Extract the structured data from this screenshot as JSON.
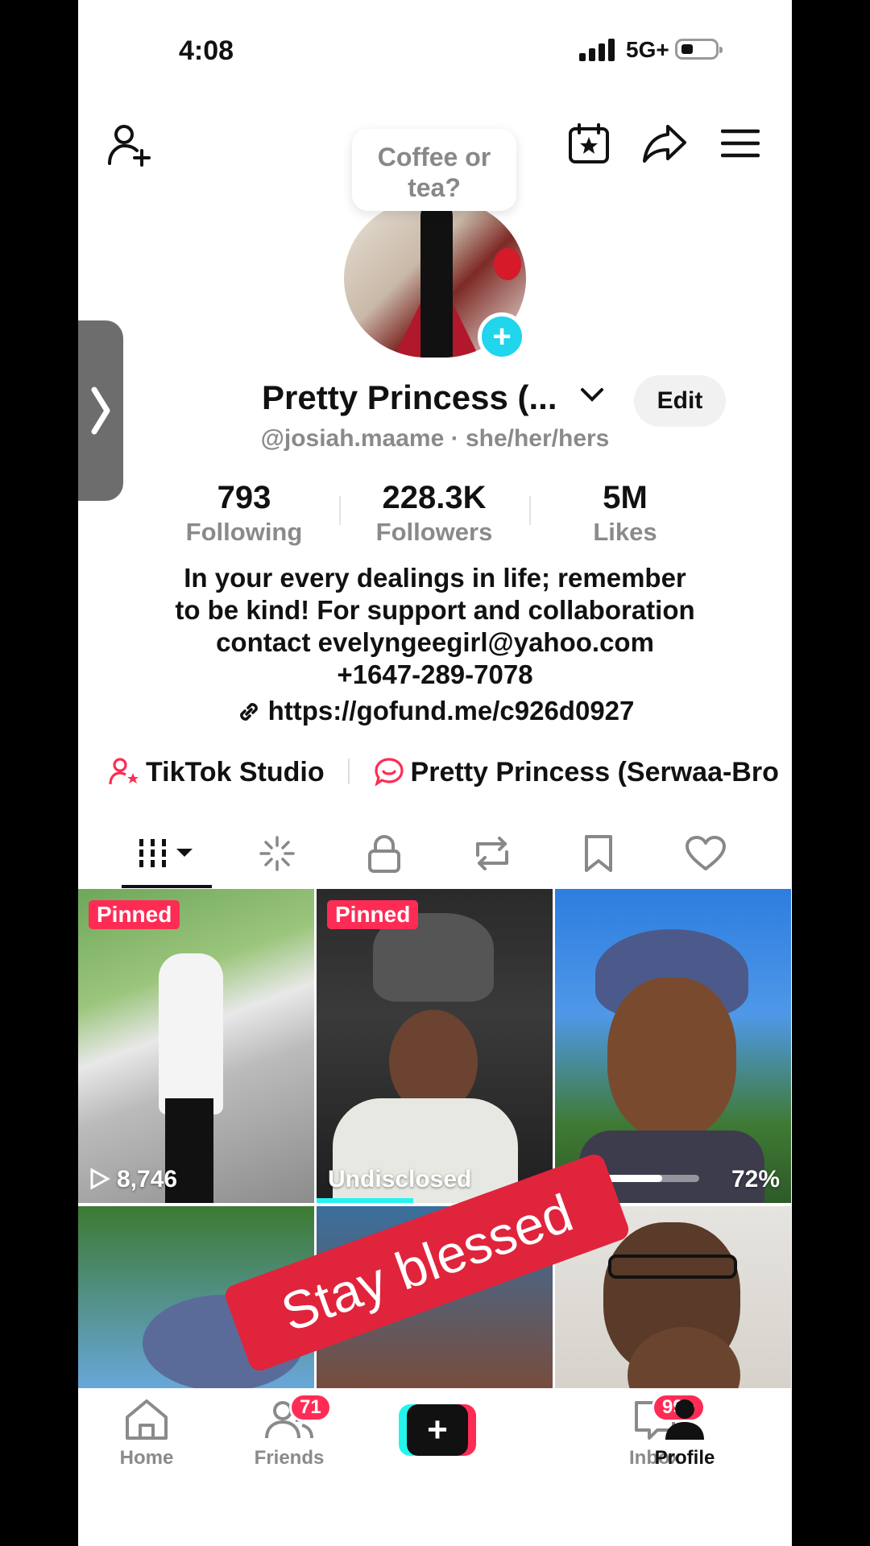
{
  "status": {
    "time": "4:08",
    "network": "5G+"
  },
  "header": {
    "add_friend_icon": "person-plus-icon",
    "calendar_icon": "calendar-star-icon",
    "share_icon": "share-arrow-icon",
    "menu_icon": "hamburger-menu-icon"
  },
  "profile": {
    "note": "Coffee or tea?",
    "name": "Pretty Princess (...",
    "edit_label": "Edit",
    "handle": "@josiah.maame · she/her/hers",
    "stats": [
      {
        "value": "793",
        "label": "Following"
      },
      {
        "value": "228.3K",
        "label": "Followers"
      },
      {
        "value": "5M",
        "label": "Likes"
      }
    ],
    "bio_lines": [
      "In your every dealings in life; remember",
      "to be kind! For support and collaboration",
      "contact evelyngeegirl@yahoo.com",
      "+1647-289-7078"
    ],
    "link": "https://gofund.me/c926d0927",
    "chips": [
      {
        "label": "TikTok Studio",
        "icon": "studio-person-star-icon"
      },
      {
        "label": "Pretty Princess (Serwaa-Bro",
        "icon": "chat-bubble-icon"
      }
    ]
  },
  "tabs": [
    {
      "name": "videos-grid",
      "icon": "grid-bars-icon"
    },
    {
      "name": "reposts-sparkle",
      "icon": "sparkle-icon"
    },
    {
      "name": "private",
      "icon": "lock-icon"
    },
    {
      "name": "reposts",
      "icon": "repost-icon"
    },
    {
      "name": "favorites",
      "icon": "bookmark-icon"
    },
    {
      "name": "liked",
      "icon": "heart-icon"
    }
  ],
  "grid": [
    {
      "pinned": "Pinned",
      "caption": "8,746",
      "caption_icon": "play-icon"
    },
    {
      "pinned": "Pinned",
      "caption": "Undisclosed"
    },
    {
      "progress_label": "72%",
      "progress": 0.72
    },
    {},
    {},
    {}
  ],
  "sticker": "Stay blessed",
  "bottom_nav": [
    {
      "label": "Home",
      "icon": "home-icon"
    },
    {
      "label": "Friends",
      "icon": "friends-icon",
      "badge": "71"
    },
    {
      "label": "",
      "icon": "create-plus-icon"
    },
    {
      "label": "Inbox",
      "icon": "inbox-icon",
      "badge": "99+"
    },
    {
      "label": "Profile",
      "icon": "profile-icon"
    }
  ],
  "colors": {
    "accent": "#fe2c55",
    "cyan": "#25f4ee",
    "text": "#111111",
    "muted": "#8a8a8a"
  }
}
